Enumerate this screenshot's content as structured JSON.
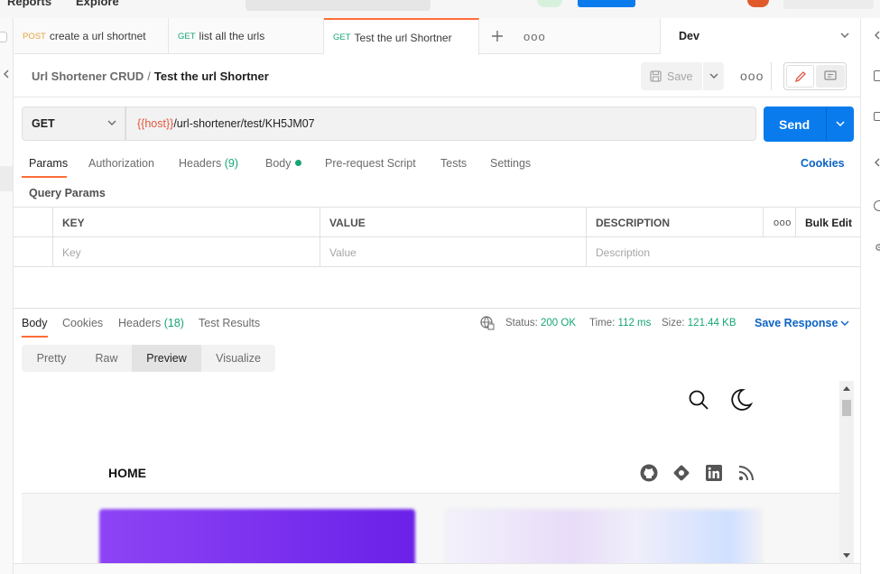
{
  "topbar": {
    "reports": "Reports",
    "explore": "Explore"
  },
  "tabs": [
    {
      "method": "POST",
      "label": "create a url shortnet"
    },
    {
      "method": "GET",
      "label": "list all the urls"
    },
    {
      "method": "GET",
      "label": "Test the url Shortner"
    }
  ],
  "environment": {
    "selected": "Dev"
  },
  "breadcrumb": {
    "collection": "Url Shortener CRUD",
    "separator": "/",
    "request": "Test the url Shortner"
  },
  "actions": {
    "save_label": "Save"
  },
  "request": {
    "method": "GET",
    "url_variable": "{{host}}",
    "url_path": "/url-shortener/test/KH5JM07",
    "send_label": "Send"
  },
  "request_tabs": {
    "params": "Params",
    "authorization": "Authorization",
    "headers": "Headers",
    "headers_count": "(9)",
    "body": "Body",
    "prerequest": "Pre-request Script",
    "tests": "Tests",
    "settings": "Settings",
    "cookies": "Cookies"
  },
  "query_params": {
    "title": "Query Params",
    "columns": {
      "key": "KEY",
      "value": "VALUE",
      "description": "DESCRIPTION",
      "bulk_edit": "Bulk Edit"
    },
    "placeholders": {
      "key": "Key",
      "value": "Value",
      "description": "Description"
    }
  },
  "response_tabs": {
    "body": "Body",
    "cookies": "Cookies",
    "headers": "Headers",
    "headers_count": "(18)",
    "test_results": "Test Results"
  },
  "response_meta": {
    "status_label": "Status:",
    "status_value": "200 OK",
    "time_label": "Time:",
    "time_value": "112 ms",
    "size_label": "Size:",
    "size_value": "121.44 KB",
    "save_response": "Save Response"
  },
  "view_modes": [
    "Pretty",
    "Raw",
    "Preview",
    "Visualize"
  ],
  "view_modes_selected": "Preview",
  "preview": {
    "nav_home": "HOME"
  },
  "colors": {
    "accent": "#ff6c37",
    "send_blue": "#097bed",
    "link_blue": "#0b63c4",
    "status_green": "#17a673",
    "variable_red": "#e2563f"
  }
}
